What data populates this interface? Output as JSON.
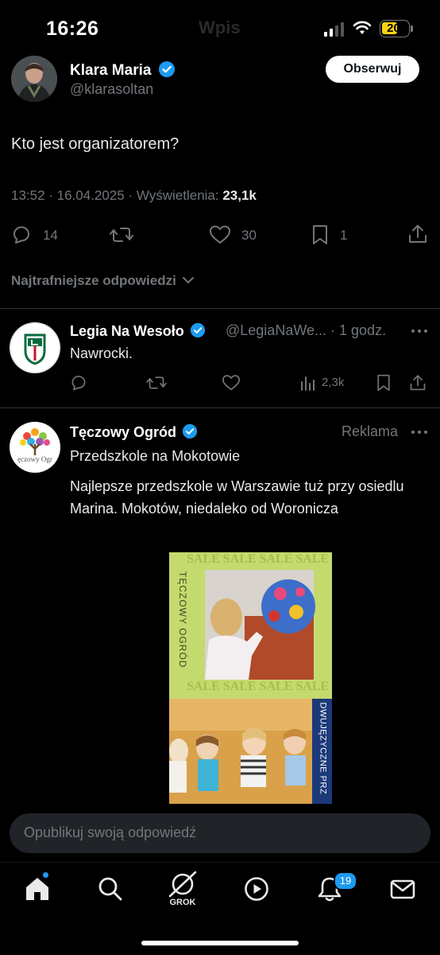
{
  "status_bar": {
    "time": "16:26",
    "ghost_title": "Wpis",
    "battery": "20"
  },
  "main_tweet": {
    "author_name": "Klara Maria",
    "author_handle": "@klarasoltan",
    "follow_label": "Obserwuj",
    "text": "Kto jest organizatorem?",
    "meta_prefix": "13:52 · 16.04.2025 · Wyświetlenia: ",
    "views": "23,1k",
    "replies": "14",
    "likes": "30",
    "bookmarks": "1",
    "verified_color": "#1d9bf0",
    "icons": [
      "reply-icon",
      "repost-icon",
      "like-icon",
      "bookmark-icon",
      "share-icon"
    ]
  },
  "replies_filter": {
    "label": "Najtrafniejsze odpowiedzi"
  },
  "reply": {
    "author_name": "Legia Na Wesoło",
    "author_handle": "@LegiaNaWe...",
    "time": "· 1 godz.",
    "text": "Nawrocki.",
    "views": "2,3k"
  },
  "ad": {
    "author_name": "Tęczowy Ogród",
    "avatar_text": "ęczowy Ogr",
    "label": "Reklama",
    "subtitle": "Przedszkole na Mokotowie",
    "body": "Najlepsze przedszkole w Warszawie tuż przy osiedlu Marina. Mokotów, niedaleko od Woronicza",
    "image": {
      "sale_text": "SALE SALE SALE SALE",
      "side_text": "TĘCZOWY OGRÓD",
      "bottom_side_text": "DWUJĘZYCZNE PRZEDSZK"
    }
  },
  "reply_box": {
    "placeholder": "Opublikuj swoją odpowiedź"
  },
  "tab_bar": {
    "grok_label": "GROK",
    "notifications_badge": "19"
  }
}
